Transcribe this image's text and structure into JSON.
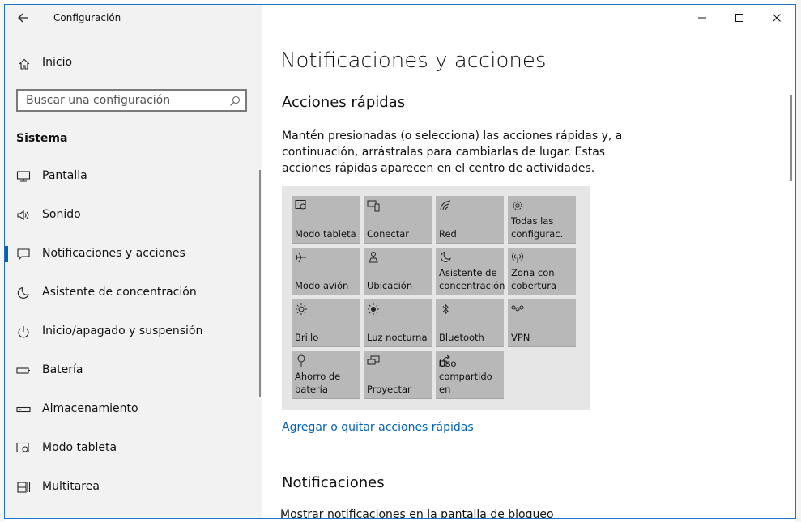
{
  "window": {
    "app_title": "Configuración",
    "controls": [
      "minimize",
      "maximize",
      "close"
    ]
  },
  "sidebar": {
    "home_label": "Inicio",
    "search_placeholder": "Buscar una configuración",
    "section_label": "Sistema",
    "items": [
      {
        "label": "Pantalla",
        "icon": "display-icon"
      },
      {
        "label": "Sonido",
        "icon": "speaker-icon"
      },
      {
        "label": "Notificaciones y acciones",
        "icon": "notification-icon",
        "selected": true
      },
      {
        "label": "Asistente de concentración",
        "icon": "moon-icon"
      },
      {
        "label": "Inicio/apagado y suspensión",
        "icon": "power-icon"
      },
      {
        "label": "Batería",
        "icon": "battery-icon"
      },
      {
        "label": "Almacenamiento",
        "icon": "storage-icon"
      },
      {
        "label": "Modo tableta",
        "icon": "tablet-mode-icon"
      },
      {
        "label": "Multitarea",
        "icon": "multitask-icon"
      }
    ]
  },
  "main": {
    "title": "Notificaciones y acciones",
    "quick_actions": {
      "heading": "Acciones rápidas",
      "description": "Mantén presionadas (o selecciona) las acciones rápidas y, a continuación, arrástralas para cambiarlas de lugar. Estas acciones rápidas aparecen en el centro de actividades.",
      "tiles": [
        {
          "label": "Modo tableta",
          "icon": "tablet-mode-icon"
        },
        {
          "label": "Conectar",
          "icon": "connect-icon"
        },
        {
          "label": "Red",
          "icon": "network-icon"
        },
        {
          "label": "Todas las\nconfigurac.",
          "icon": "gear-icon"
        },
        {
          "label": "Modo avión",
          "icon": "airplane-icon"
        },
        {
          "label": "Ubicación",
          "icon": "location-icon"
        },
        {
          "label": "Asistente de\nconcentración",
          "icon": "moon-icon"
        },
        {
          "label": "Zona con\ncobertura",
          "icon": "hotspot-icon"
        },
        {
          "label": "Brillo",
          "icon": "brightness-icon"
        },
        {
          "label": "Luz nocturna",
          "icon": "night-light-icon"
        },
        {
          "label": "Bluetooth",
          "icon": "bluetooth-icon"
        },
        {
          "label": "VPN",
          "icon": "vpn-icon"
        },
        {
          "label": "Ahorro de\nbatería",
          "icon": "battery-saver-icon"
        },
        {
          "label": "Proyectar",
          "icon": "project-icon"
        },
        {
          "label": "Uso\ncompartido en",
          "icon": "share-icon"
        }
      ],
      "link": "Agregar o quitar acciones rápidas"
    },
    "notifications": {
      "heading": "Notificaciones",
      "partial_text": "Mostrar notificaciones en la pantalla de bloqueo"
    }
  }
}
